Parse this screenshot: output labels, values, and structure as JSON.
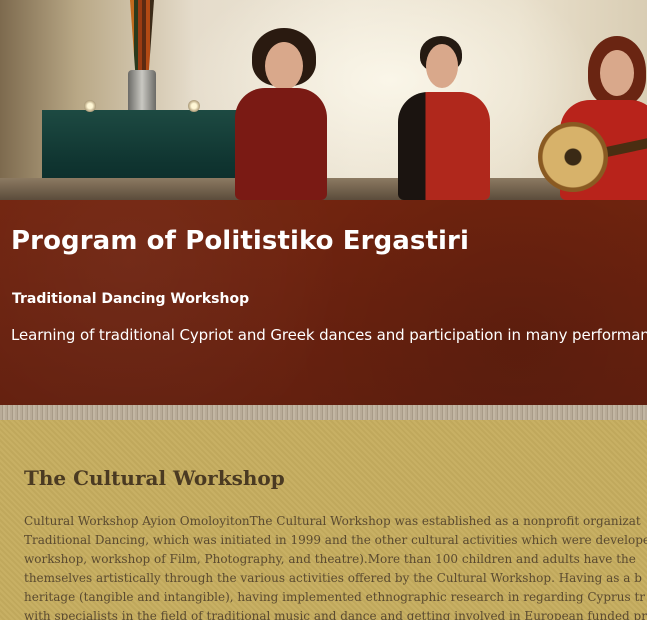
{
  "hero": {
    "image_description_icon": "performance-photo"
  },
  "header": {
    "title": "Program of Politistiko Ergastiri",
    "subtitle": "Traditional Dancing Workshop",
    "tagline": "Learning of traditional Cypriot and Greek dances and participation in many performances"
  },
  "section": {
    "heading": "The Cultural Workshop",
    "lines": [
      "Cultural Workshop Ayion OmoloyitonThe Cultural Workshop was established as a nonprofit organizat",
      "Traditional Dancing, which was initiated in 1999 and the other cultural activities which were develope",
      "workshop, workshop of  Film, Photography, and theatre).More than 100 children and adults have the",
      "themselves artistically through the various activities offered by the Cultural Workshop. Having as a b",
      "heritage (tangible and intangible),  having implemented ethnographic research in regarding Cyprus tr",
      "with specialists  in the field of traditional music and dance and getting involved in European funded pr"
    ]
  },
  "colors": {
    "band": "#6d2211",
    "content_bg": "#c6ad5f",
    "heading": "#4a3a22",
    "body_text": "#5a4a30"
  }
}
